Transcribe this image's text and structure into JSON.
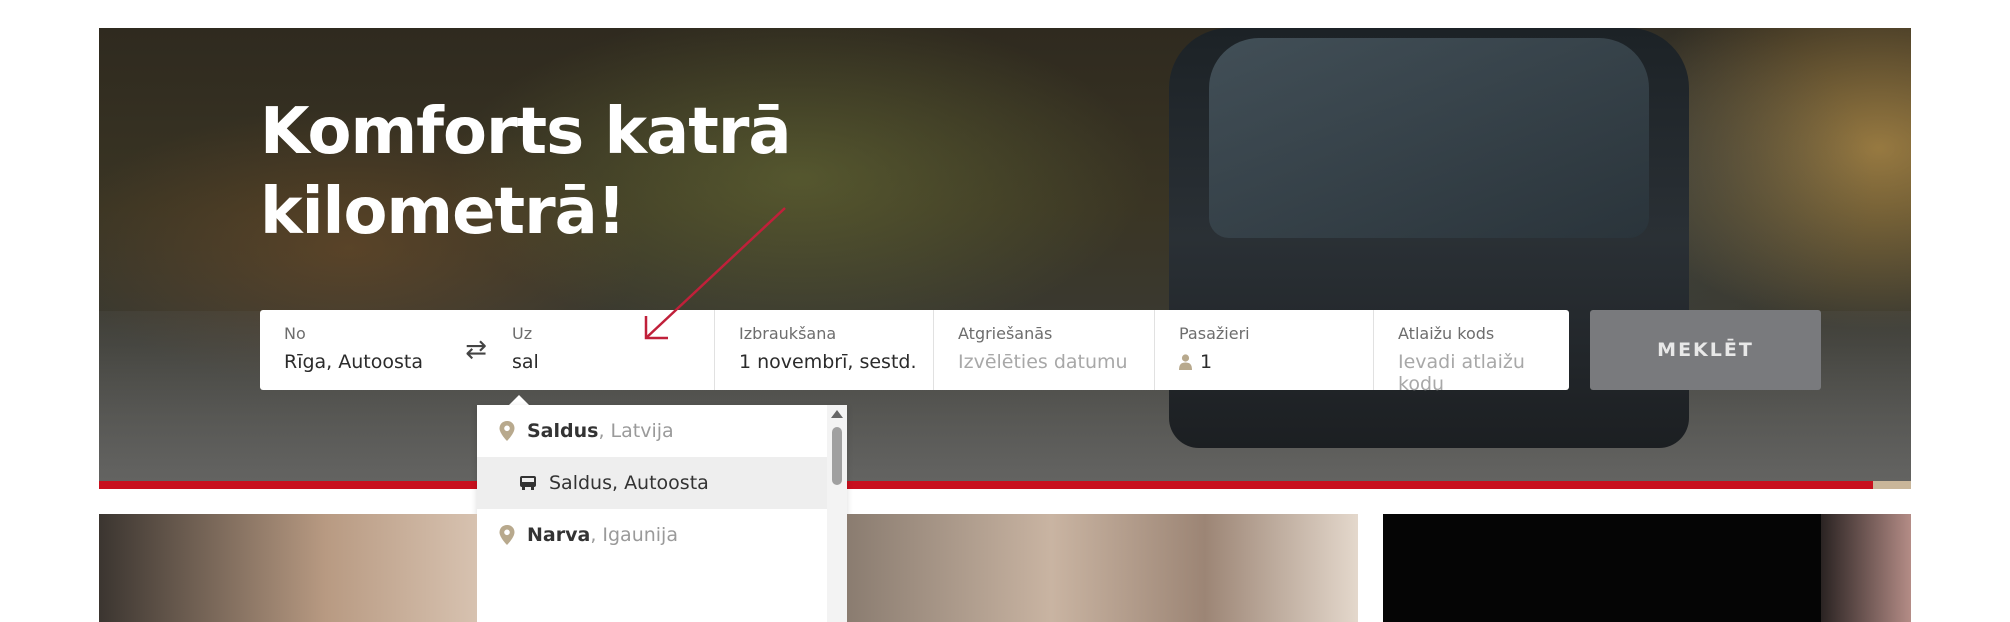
{
  "hero": {
    "title_line1": "Komforts katrā",
    "title_line2": "kilometrā!"
  },
  "search": {
    "from": {
      "label": "No",
      "value": "Rīga, Autoosta"
    },
    "swap_icon": "swap-arrows-icon",
    "to": {
      "label": "Uz",
      "value": "sal"
    },
    "departure": {
      "label": "Izbraukšana",
      "value": "1 novembrī, sestd."
    },
    "return": {
      "label": "Atgriešanās",
      "placeholder": "Izvēlēties datumu"
    },
    "passengers": {
      "label": "Pasažieri",
      "value": "1",
      "icon": "person-icon"
    },
    "discount": {
      "label": "Atlaižu kods",
      "placeholder": "Ievadi atlaižu kodu"
    },
    "submit_label": "MEKLĒT"
  },
  "dropdown": {
    "items": [
      {
        "type": "city",
        "name": "Saldus",
        "country": ", Latvija",
        "icon": "location-pin-icon"
      },
      {
        "type": "stop",
        "name": "Saldus, Autoosta",
        "icon": "bus-icon"
      },
      {
        "type": "city",
        "name": "Narva",
        "country": ", Igaunija",
        "icon": "location-pin-icon"
      }
    ]
  },
  "colors": {
    "accent_red": "#c8101e",
    "button_gray": "#797a7d",
    "arrow_annotation": "#c0203a"
  }
}
